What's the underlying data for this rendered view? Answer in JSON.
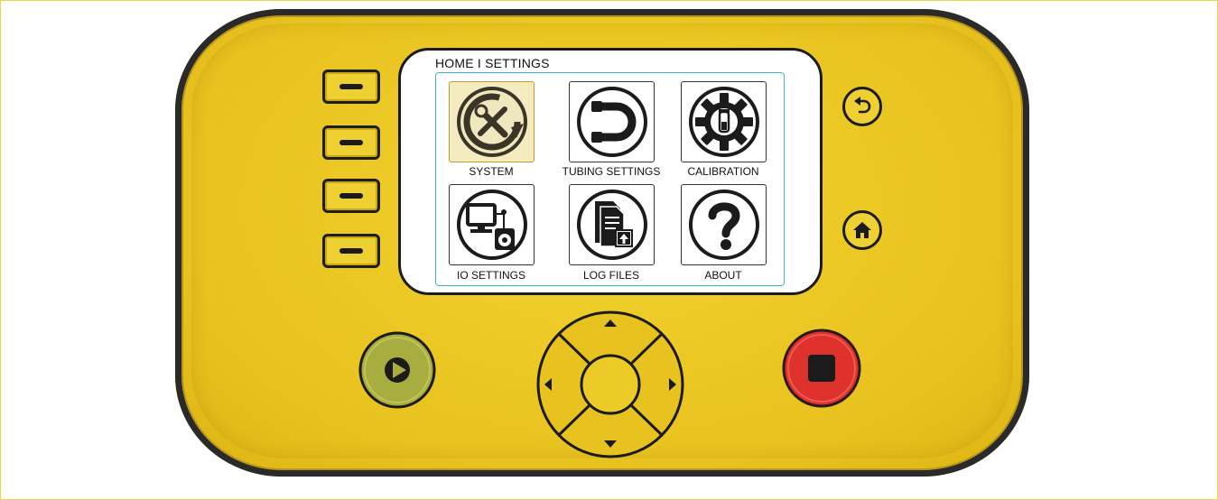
{
  "screen": {
    "breadcrumb": "HOME I SETTINGS",
    "tiles": [
      {
        "label": "SYSTEM",
        "icon": "system-tools-icon",
        "selected": true
      },
      {
        "label": "TUBING SETTINGS",
        "icon": "tubing-icon",
        "selected": false
      },
      {
        "label": "CALIBRATION",
        "icon": "calibration-gear-icon",
        "selected": false
      },
      {
        "label": "IO SETTINGS",
        "icon": "computer-pump-icon",
        "selected": false
      },
      {
        "label": "LOG FILES",
        "icon": "document-upload-icon",
        "selected": false
      },
      {
        "label": "ABOUT",
        "icon": "question-mark-icon",
        "selected": false
      }
    ]
  },
  "hardware": {
    "soft_keys": [
      "soft-key-1",
      "soft-key-2",
      "soft-key-3",
      "soft-key-4"
    ],
    "back_icon": "back-arrow-icon",
    "home_icon": "home-icon",
    "play_icon": "play-icon",
    "stop_icon": "stop-icon",
    "dpad_icons": [
      "arrow-up-icon",
      "arrow-down-icon",
      "arrow-left-icon",
      "arrow-right-icon"
    ]
  },
  "colors": {
    "device_body": "#e8c21f",
    "device_outline": "#2a2a2a",
    "screen_frame": "#3fb4cf",
    "selected_tile": "#f4ecc0",
    "play_button": "#a7ad3e",
    "stop_button": "#e0322c"
  }
}
